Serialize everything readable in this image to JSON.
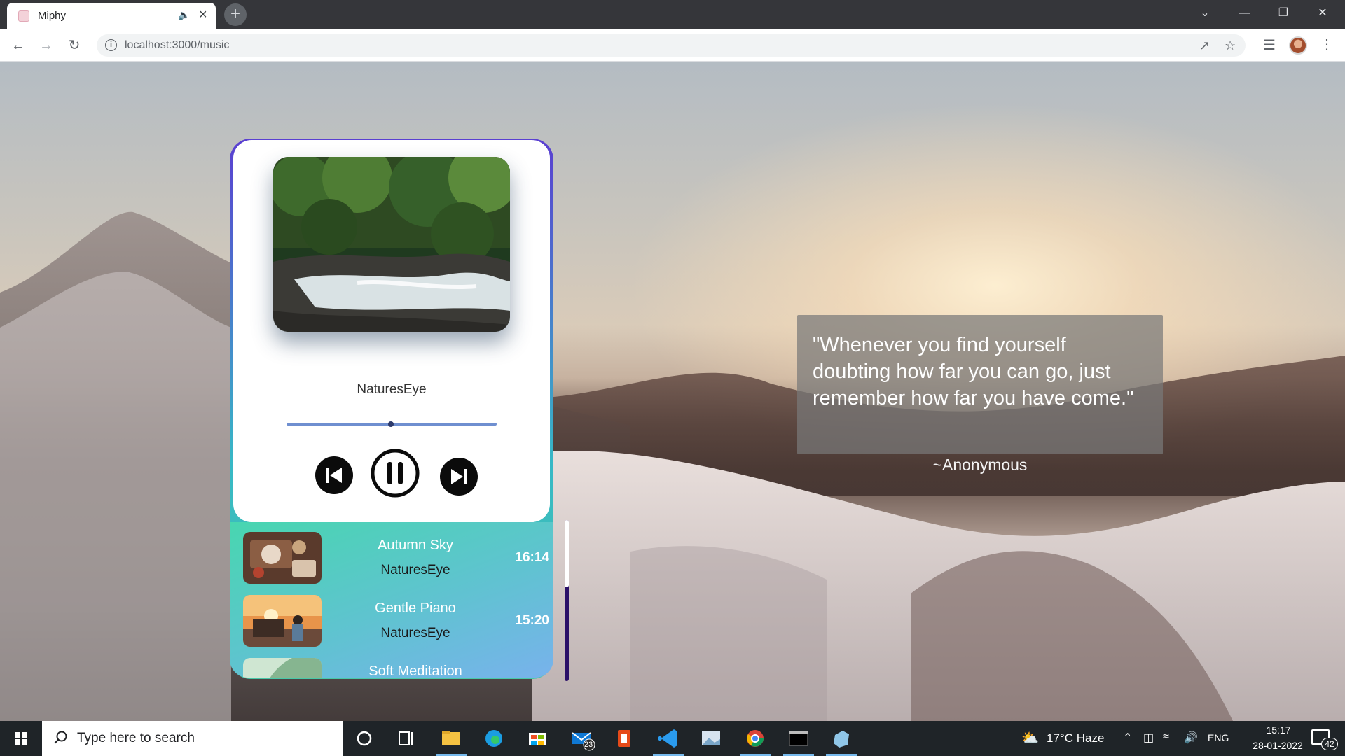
{
  "browser": {
    "tab_title": "Miphy",
    "url": "localhost:3000/music",
    "new_tab": "+"
  },
  "player": {
    "now_playing_title": "NaturesEye",
    "progress_percent": 50,
    "colors": {
      "card_gradient_top": "#5a3fd1",
      "card_gradient_bottom": "#47c8a8",
      "progress": "#6f8fd0"
    }
  },
  "playlist": [
    {
      "title": "Autumn Sky",
      "artist": "NaturesEye",
      "duration": "16:14"
    },
    {
      "title": "Gentle Piano",
      "artist": "NaturesEye",
      "duration": "15:20"
    },
    {
      "title": "Soft Meditation",
      "artist": "",
      "duration": ""
    }
  ],
  "quote": {
    "text": "\"Whenever you find yourself doubting how far you can go, just remember how far you have come.\"",
    "author": "~Anonymous"
  },
  "taskbar": {
    "search_placeholder": "Type here to search",
    "mail_badge": "23",
    "weather": "17°C  Haze",
    "language": "ENG",
    "time": "15:17",
    "date": "28-01-2022",
    "notification_count": "42"
  }
}
